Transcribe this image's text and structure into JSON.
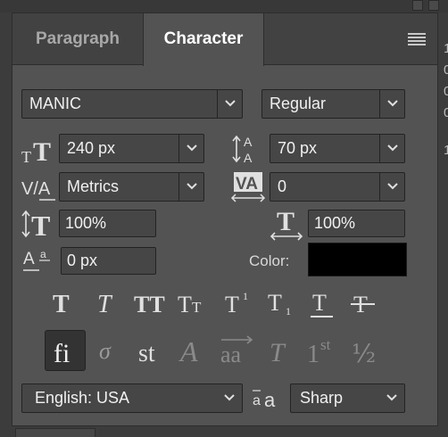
{
  "tabs": [
    {
      "label": "Paragraph",
      "active": false
    },
    {
      "label": "Character",
      "active": true
    }
  ],
  "font": {
    "family": "MANIC",
    "style": "Regular"
  },
  "size": {
    "value": "240 px"
  },
  "leading": {
    "value": "70 px"
  },
  "kerning": {
    "value": "Metrics"
  },
  "tracking": {
    "value": "0"
  },
  "vertical_scale": {
    "value": "100%"
  },
  "horizontal_scale": {
    "value": "100%"
  },
  "baseline_shift": {
    "value": "0 px"
  },
  "color": {
    "label": "Color:",
    "swatch": "#000000"
  },
  "format_buttons": [
    "faux-bold",
    "faux-italic",
    "all-caps",
    "small-caps",
    "superscript",
    "subscript",
    "underline",
    "strikethrough"
  ],
  "opentype_buttons": [
    {
      "name": "standard-ligatures",
      "glyph": "fi",
      "active": true
    },
    {
      "name": "contextual-alternates",
      "glyph": "σ",
      "active": false
    },
    {
      "name": "discretionary-ligatures",
      "glyph": "st",
      "active": false
    },
    {
      "name": "swash",
      "glyph": "A",
      "active": false
    },
    {
      "name": "stylistic-alternates",
      "glyph": "aa",
      "active": false
    },
    {
      "name": "titling-alternates",
      "glyph": "T",
      "active": false
    },
    {
      "name": "ordinals",
      "glyph": "1st",
      "active": false
    },
    {
      "name": "fractions",
      "glyph": "½",
      "active": false
    }
  ],
  "language": {
    "value": "English: USA"
  },
  "antialias": {
    "value": "Sharp"
  },
  "colors": {
    "panel_bg": "#535353",
    "field_bg": "#464646",
    "active_bg": "#333333"
  }
}
